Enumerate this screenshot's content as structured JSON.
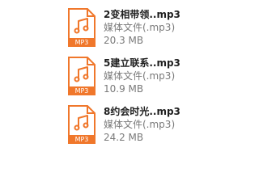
{
  "files": [
    {
      "name": "2变相带领..mp3",
      "type": "媒体文件(.mp3)",
      "size": "20.3 MB",
      "icon": "mp3-audio-file-icon",
      "icon_label": "MP3"
    },
    {
      "name": "5建立联系..mp3",
      "type": "媒体文件(.mp3)",
      "size": "10.9 MB",
      "icon": "mp3-audio-file-icon",
      "icon_label": "MP3"
    },
    {
      "name": "8约会时光..mp3",
      "type": "媒体文件(.mp3)",
      "size": "24.2 MB",
      "icon": "mp3-audio-file-icon",
      "icon_label": "MP3"
    }
  ],
  "colors": {
    "accent": "#F0772B",
    "icon_fill": "#FFFFFF",
    "name_text": "#1F1F1F",
    "meta_text": "#7A7A7A"
  }
}
